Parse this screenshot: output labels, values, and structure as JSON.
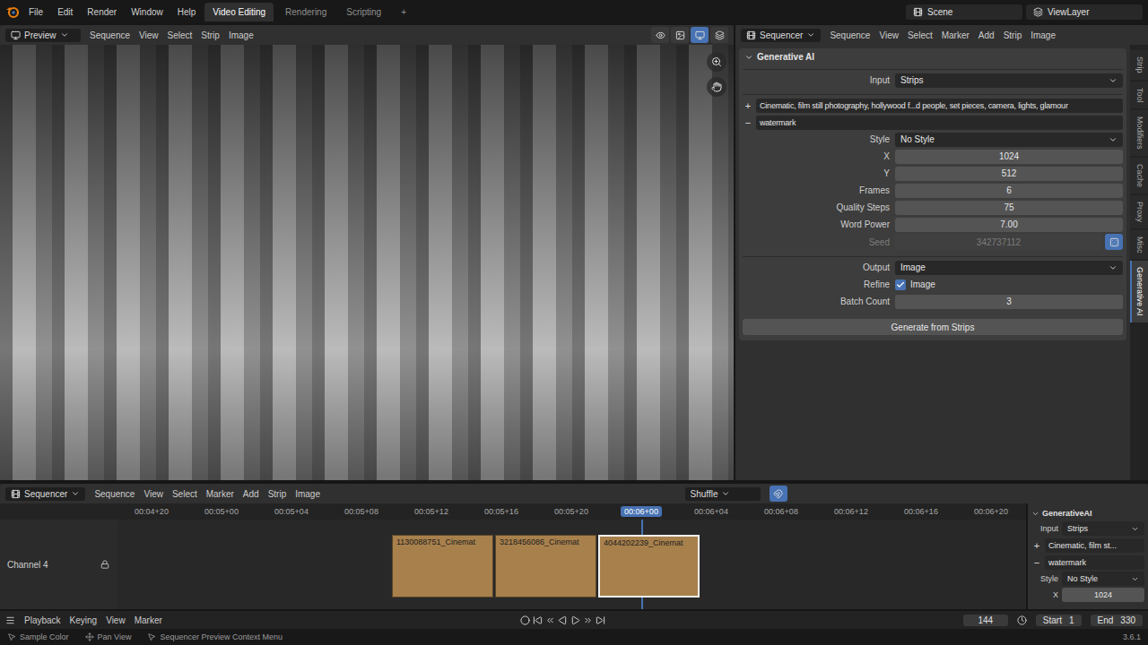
{
  "menu": [
    "File",
    "Edit",
    "Render",
    "Window",
    "Help"
  ],
  "workspaces": [
    {
      "label": "Video Editing",
      "selected": true
    },
    {
      "label": "Rendering",
      "selected": false
    },
    {
      "label": "Scripting",
      "selected": false
    },
    {
      "label": "+",
      "selected": false
    }
  ],
  "scene": "Scene",
  "view_layer": "ViewLayer",
  "preview_header": {
    "mode": "Preview",
    "menus": [
      "Sequence",
      "View",
      "Select",
      "Strip",
      "Image"
    ]
  },
  "properties_header": {
    "mode": "Sequencer",
    "menus": [
      "Sequence",
      "View",
      "Select",
      "Marker",
      "Add",
      "Strip",
      "Image"
    ]
  },
  "panel": {
    "title": "Generative AI",
    "groups": [
      [
        {
          "kind": "dropdown",
          "label": "Input",
          "value": "Strips"
        }
      ],
      [
        {
          "kind": "prompt",
          "icon": "+",
          "value": "Cinematic, film still photography, hollywood f...d people, set pieces, camera, lights, glamour"
        },
        {
          "kind": "prompt",
          "icon": "−",
          "value": "watermark"
        },
        {
          "kind": "dropdown",
          "label": "Style",
          "value": "No Style"
        },
        {
          "kind": "number",
          "label": "X",
          "value": "1024",
          "disabled": false
        },
        {
          "kind": "number",
          "label": "Y",
          "value": "512",
          "disabled": false
        },
        {
          "kind": "number",
          "label": "Frames",
          "value": "6",
          "disabled": false
        },
        {
          "kind": "number",
          "label": "Quality Steps",
          "value": "75",
          "disabled": false
        },
        {
          "kind": "number",
          "label": "Word Power",
          "value": "7.00",
          "disabled": false
        },
        {
          "kind": "seed",
          "label": "Seed",
          "value": "342737112",
          "disabled": true
        }
      ],
      [
        {
          "kind": "dropdown",
          "label": "Output",
          "value": "Image"
        },
        {
          "kind": "checkbox",
          "label": "Refine",
          "text": "Image",
          "checked": true
        },
        {
          "kind": "number",
          "label": "Batch Count",
          "value": "3",
          "disabled": false
        }
      ]
    ],
    "button": "Generate from Strips"
  },
  "side_tabs": [
    {
      "label": "Strip",
      "selected": false
    },
    {
      "label": "Tool",
      "selected": false
    },
    {
      "label": "Modifiers",
      "selected": false
    },
    {
      "label": "Cache",
      "selected": false
    },
    {
      "label": "Proxy",
      "selected": false
    },
    {
      "label": "Misc",
      "selected": false
    },
    {
      "label": "Generative AI",
      "selected": true
    }
  ],
  "timeline": {
    "mode": "Sequencer",
    "menus": [
      "Sequence",
      "View",
      "Select",
      "Marker",
      "Add",
      "Strip",
      "Image"
    ],
    "snap": "Shuffle",
    "ticks": [
      {
        "label": "00:04+20",
        "selected": false
      },
      {
        "label": "00:05+00",
        "selected": false
      },
      {
        "label": "00:05+04",
        "selected": false
      },
      {
        "label": "00:05+08",
        "selected": false
      },
      {
        "label": "00:05+12",
        "selected": false
      },
      {
        "label": "00:05+16",
        "selected": false
      },
      {
        "label": "00:05+20",
        "selected": false
      },
      {
        "label": "00:06+00",
        "selected": true
      },
      {
        "label": "00:06+04",
        "selected": false
      },
      {
        "label": "00:06+08",
        "selected": false
      },
      {
        "label": "00:06+12",
        "selected": false
      },
      {
        "label": "00:06+16",
        "selected": false
      },
      {
        "label": "00:06+20",
        "selected": false
      }
    ],
    "channel": "Channel 4",
    "strips": [
      {
        "label": "1130088751_Cinemat",
        "selected": false
      },
      {
        "label": "3218456086_Cinemat",
        "selected": false
      },
      {
        "label": "4044202239_Cinemat",
        "selected": true
      }
    ]
  },
  "mini_panel": {
    "title": "GenerativeAI",
    "rows": [
      {
        "kind": "dropdown",
        "label": "Input",
        "value": "Strips"
      },
      {
        "kind": "prompt",
        "icon": "+",
        "value": "Cinematic, film st..."
      },
      {
        "kind": "prompt",
        "icon": "−",
        "value": "watermark"
      },
      {
        "kind": "dropdown",
        "label": "Style",
        "value": "No Style"
      },
      {
        "kind": "number",
        "label": "X",
        "value": "1024"
      }
    ]
  },
  "playback": {
    "menus": [
      "Playback",
      "Keying",
      "View",
      "Marker"
    ],
    "frame": "144",
    "start_label": "Start",
    "start": "1",
    "end_label": "End",
    "end": "330"
  },
  "status_bar": {
    "items": [
      "Sample Color",
      "Pan View",
      "Sequencer Preview Context Menu"
    ],
    "version": "3.6.1"
  }
}
